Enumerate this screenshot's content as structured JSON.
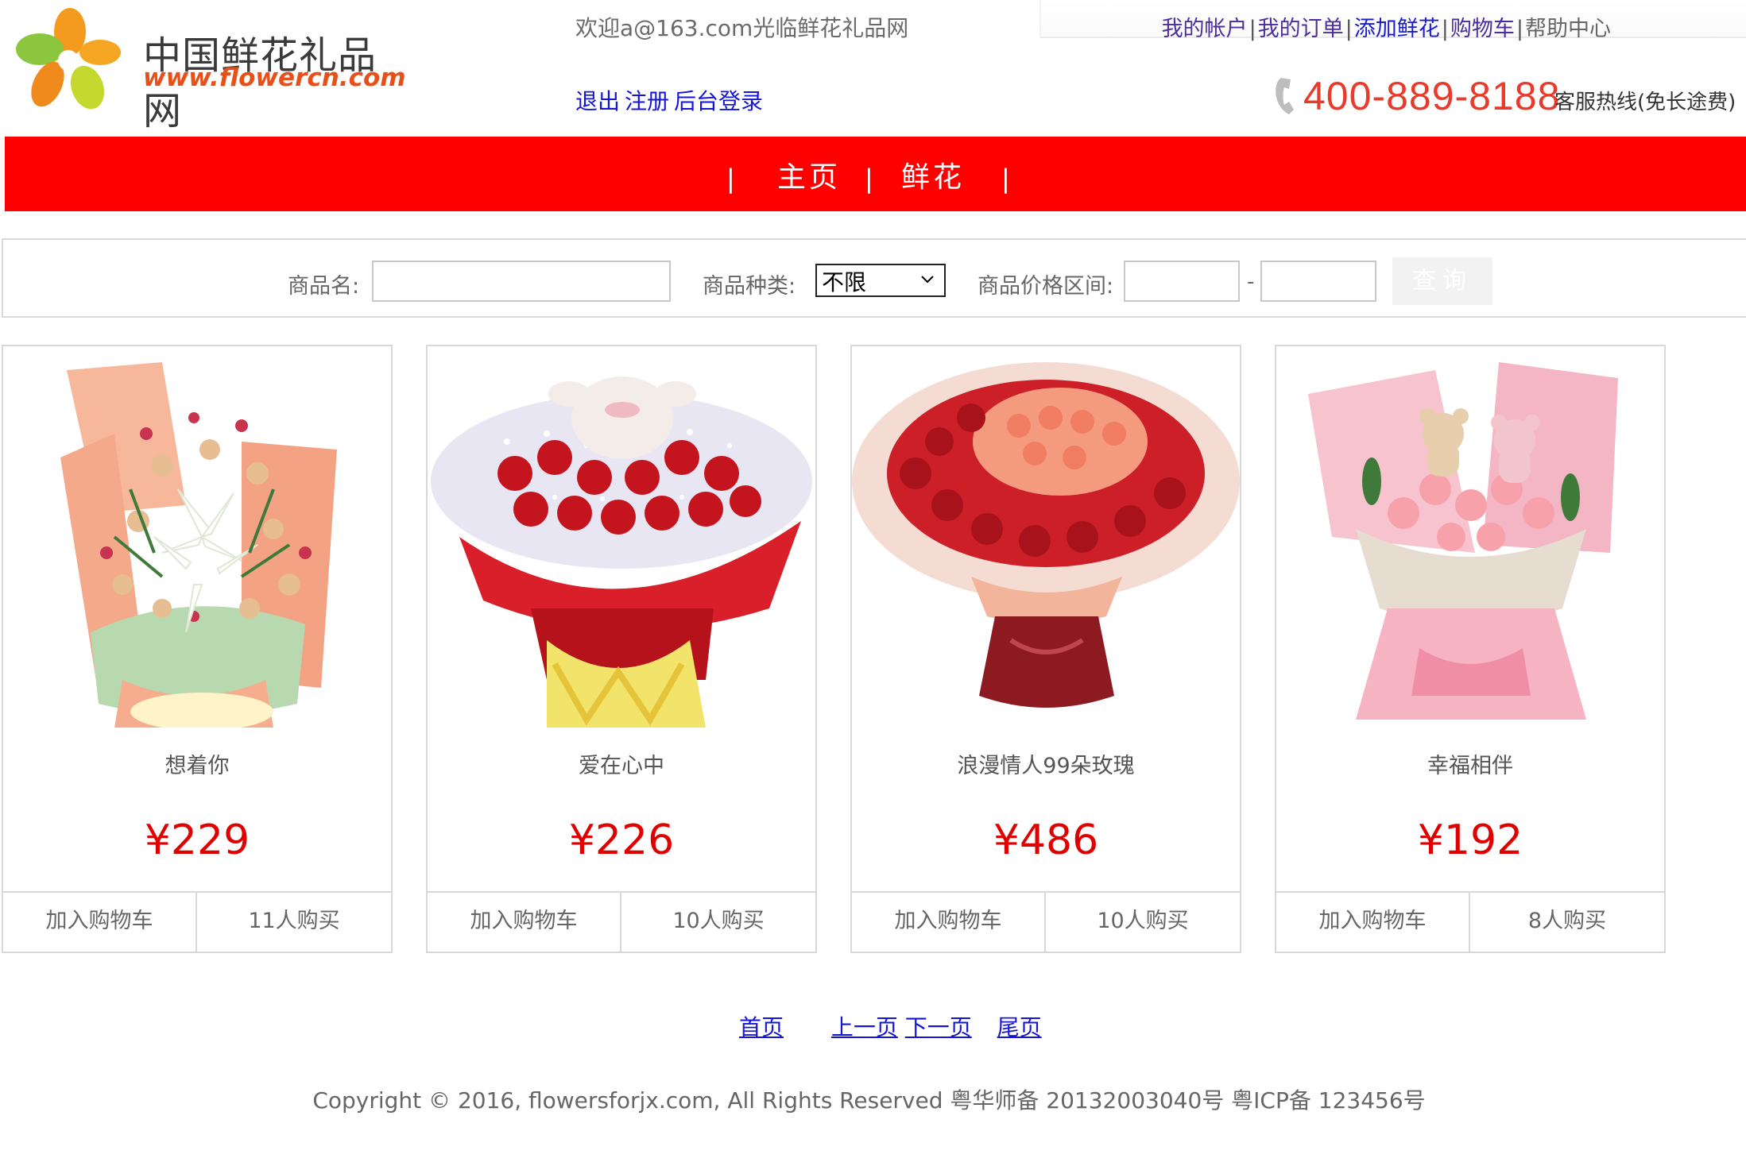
{
  "header": {
    "logo_cn": "中国鲜花礼品网",
    "logo_url": "www.flowercn.com",
    "welcome": "欢迎a@163.com光临鲜花礼品网",
    "auth_links": [
      "退出",
      "注册",
      "后台登录"
    ],
    "top_links": [
      "我的帐户",
      "我的订单",
      "添加鲜花",
      "购物车",
      "帮助中心"
    ],
    "hotline_number": "400-889-8188",
    "hotline_text": "客服热线(免长途费)"
  },
  "nav": {
    "items": [
      "主页",
      "鲜花"
    ],
    "separator": "|"
  },
  "search": {
    "name_label": "商品名:",
    "name_value": "",
    "category_label": "商品种类:",
    "category_selected": "不限",
    "price_label": "商品价格区间:",
    "price_min": "",
    "price_max": "",
    "range_dash": "-",
    "button_label": "查询"
  },
  "products": [
    {
      "name": "想着你",
      "price": "¥229",
      "add_cart": "加入购物车",
      "buyers": "11人购买"
    },
    {
      "name": "爱在心中",
      "price": "¥226",
      "add_cart": "加入购物车",
      "buyers": "10人购买"
    },
    {
      "name": "浪漫情人99朵玫瑰",
      "price": "¥486",
      "add_cart": "加入购物车",
      "buyers": "10人购买"
    },
    {
      "name": "幸福相伴",
      "price": "¥192",
      "add_cart": "加入购物车",
      "buyers": "8人购买"
    }
  ],
  "pagination": {
    "first": "首页",
    "prev": "上一页",
    "next": "下一页",
    "last": "尾页"
  },
  "footer": {
    "copyright": "Copyright © 2016, flowersforjx.com, All Rights Reserved 粤华师备 20132003040号 粤ICP备 123456号"
  },
  "colors": {
    "nav_red": "#ff0000",
    "price_red": "#e00000",
    "link_blue": "#1515d8",
    "hotline_red": "#e83b2b",
    "logo_orange": "#e8501a"
  }
}
